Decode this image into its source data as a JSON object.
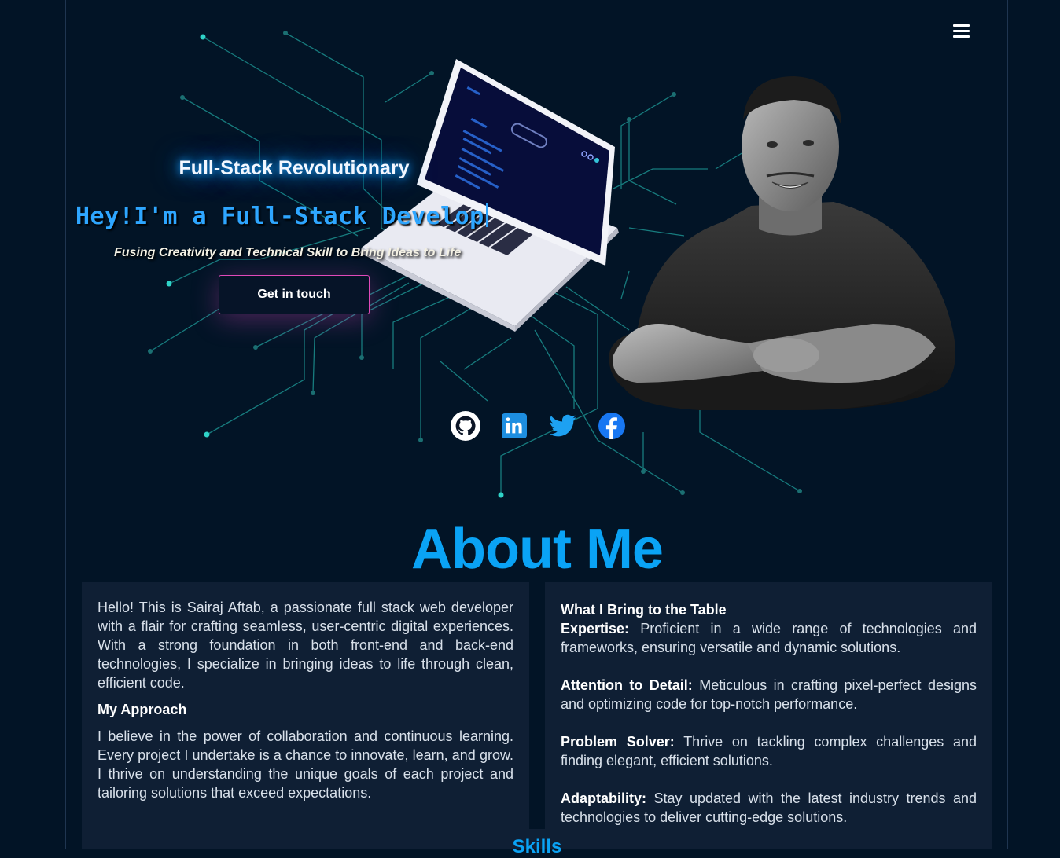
{
  "hero": {
    "eyebrow": "Full-Stack Revolutionary",
    "headline": "Hey!I'm a Full-Stack Develop",
    "tagline": "Fusing Creativity and Technical Skill to Bring Ideas to Life",
    "cta_label": "Get in touch"
  },
  "nav": {
    "menu_icon": "hamburger-icon"
  },
  "socials": [
    {
      "name": "github",
      "icon": "github-icon"
    },
    {
      "name": "linkedin",
      "icon": "linkedin-icon"
    },
    {
      "name": "twitter",
      "icon": "twitter-icon"
    },
    {
      "name": "facebook",
      "icon": "facebook-icon"
    }
  ],
  "about": {
    "title": "About Me",
    "intro": "Hello! This is Sairaj Aftab, a passionate full stack web developer with a flair for crafting seamless, user-centric digital experiences. With a strong foundation in both front-end and back-end technologies, I specialize in bringing ideas to life through clean, efficient code.",
    "approach_heading": "My Approach",
    "approach_text": "I believe in the power of collaboration and continuous learning. Every project I undertake is a chance to innovate, learn, and grow. I thrive on understanding the unique goals of each project and tailoring solutions that exceed expectations.",
    "bring_heading": "What I Bring to the Table",
    "items": [
      {
        "label": "Expertise:",
        "text": "Proficient in a wide range of technologies and frameworks, ensuring versatile and dynamic solutions."
      },
      {
        "label": "Attention to Detail:",
        "text": "Meticulous in crafting pixel-perfect designs and optimizing code for top-notch performance."
      },
      {
        "label": "Problem Solver:",
        "text": "Thrive on tackling complex challenges and finding elegant, efficient solutions."
      },
      {
        "label": "Adaptability:",
        "text": "Stay updated with the latest industry trends and technologies to deliver cutting-edge solutions."
      }
    ]
  },
  "skills": {
    "title": "Skills"
  },
  "colors": {
    "background": "#021426",
    "accent": "#0aa3f5",
    "card": "#0f1f34",
    "circuit": "#2fd3c8",
    "cta_border": "#e04ab9"
  }
}
